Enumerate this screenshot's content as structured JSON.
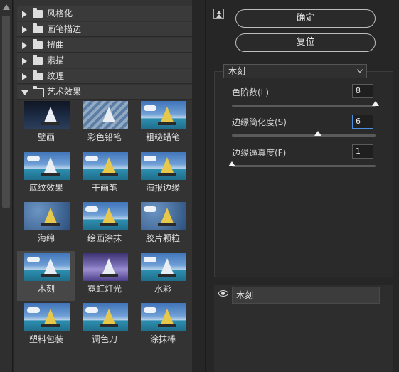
{
  "categories": [
    {
      "label": "风格化",
      "open": false
    },
    {
      "label": "画笔描边",
      "open": false
    },
    {
      "label": "扭曲",
      "open": false
    },
    {
      "label": "素描",
      "open": false
    },
    {
      "label": "纹理",
      "open": false
    },
    {
      "label": "艺术效果",
      "open": true
    }
  ],
  "filters": [
    "壁画",
    "彩色铅笔",
    "粗糙蜡笔",
    "底纹效果",
    "干画笔",
    "海报边缘",
    "海绵",
    "绘画涂抹",
    "胶片颗粒",
    "木刻",
    "霓虹灯光",
    "水彩",
    "塑料包装",
    "调色刀",
    "涂抹棒"
  ],
  "selected_filter": "木刻",
  "buttons": {
    "ok": "确定",
    "reset": "复位"
  },
  "effect_select": "木刻",
  "params": [
    {
      "label": "色阶数(L)",
      "value": "8",
      "level": 1.0
    },
    {
      "label": "边缘简化度(S)",
      "value": "6",
      "level": 0.6
    },
    {
      "label": "边缘逼真度(F)",
      "value": "1",
      "level": 0.0
    }
  ],
  "layer": {
    "name": "木刻"
  }
}
